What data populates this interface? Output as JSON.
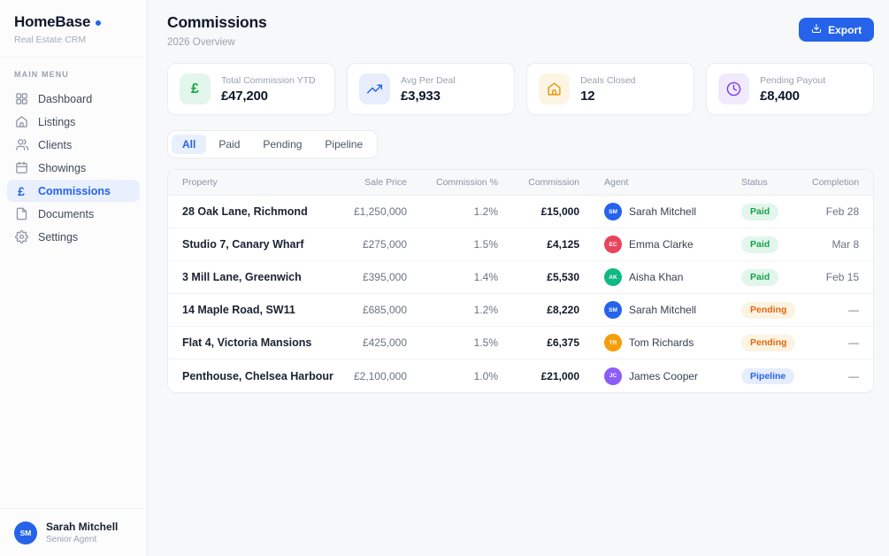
{
  "brand": {
    "name": "HomeBase",
    "subtitle": "Real Estate CRM",
    "accent_color": "#2563eb"
  },
  "sidebar": {
    "section_label": "MAIN MENU",
    "items": [
      {
        "label": "Dashboard",
        "icon": "dashboard-icon",
        "active": false
      },
      {
        "label": "Listings",
        "icon": "home-icon",
        "active": false
      },
      {
        "label": "Clients",
        "icon": "users-icon",
        "active": false
      },
      {
        "label": "Showings",
        "icon": "calendar-icon",
        "active": false
      },
      {
        "label": "Commissions",
        "icon": "pound-icon",
        "active": true
      },
      {
        "label": "Documents",
        "icon": "document-icon",
        "active": false
      },
      {
        "label": "Settings",
        "icon": "gear-icon",
        "active": false
      }
    ],
    "profile": {
      "initials": "SM",
      "name": "Sarah Mitchell",
      "role": "Senior Agent",
      "avatar_color": "#2563eb"
    }
  },
  "header": {
    "title": "Commissions",
    "subtitle": "2026 Overview"
  },
  "toolbar": {
    "export_label": "Export",
    "export_icon": "download-icon"
  },
  "stats": [
    {
      "label": "Total Commission YTD",
      "value": "£47,200",
      "icon": "pound-icon",
      "fg": "#16a34a",
      "bg": "#e3f6ec"
    },
    {
      "label": "Avg Per Deal",
      "value": "£3,933",
      "icon": "trending-up-icon",
      "fg": "#2563eb",
      "bg": "#e7edfc"
    },
    {
      "label": "Deals Closed",
      "value": "12",
      "icon": "home-icon",
      "fg": "#e8930c",
      "bg": "#fdf5e3"
    },
    {
      "label": "Pending Payout",
      "value": "£8,400",
      "icon": "clock-icon",
      "fg": "#7c3aed",
      "bg": "#f0eafd"
    }
  ],
  "filters": {
    "tabs": [
      {
        "label": "All",
        "active": true
      },
      {
        "label": "Paid",
        "active": false
      },
      {
        "label": "Pending",
        "active": false
      },
      {
        "label": "Pipeline",
        "active": false
      }
    ]
  },
  "table": {
    "columns": [
      "Property",
      "Sale Price",
      "Commission %",
      "Commission",
      "Agent",
      "Status",
      "Completion"
    ],
    "status_styles": {
      "Paid": {
        "bg": "#e2f6eb",
        "fg": "#17a24b"
      },
      "Pending": {
        "bg": "#fdf3e2",
        "fg": "#e2680f"
      },
      "Pipeline": {
        "bg": "#e6edfc",
        "fg": "#2563eb"
      }
    },
    "rows": [
      {
        "property": "28 Oak Lane, Richmond",
        "sale_price": "£1,250,000",
        "commission_pct": "1.2%",
        "commission": "£15,000",
        "agent": {
          "initials": "SM",
          "name": "Sarah Mitchell",
          "color": "#2563eb"
        },
        "status": "Paid",
        "completion": "Feb 28"
      },
      {
        "property": "Studio 7, Canary Wharf",
        "sale_price": "£275,000",
        "commission_pct": "1.5%",
        "commission": "£4,125",
        "agent": {
          "initials": "EC",
          "name": "Emma Clarke",
          "color": "#e8445e"
        },
        "status": "Paid",
        "completion": "Mar 8"
      },
      {
        "property": "3 Mill Lane, Greenwich",
        "sale_price": "£395,000",
        "commission_pct": "1.4%",
        "commission": "£5,530",
        "agent": {
          "initials": "AK",
          "name": "Aisha Khan",
          "color": "#10b981"
        },
        "status": "Paid",
        "completion": "Feb 15"
      },
      {
        "property": "14 Maple Road, SW11",
        "sale_price": "£685,000",
        "commission_pct": "1.2%",
        "commission": "£8,220",
        "agent": {
          "initials": "SM",
          "name": "Sarah Mitchell",
          "color": "#2563eb"
        },
        "status": "Pending",
        "completion": "—"
      },
      {
        "property": "Flat 4, Victoria Mansions",
        "sale_price": "£425,000",
        "commission_pct": "1.5%",
        "commission": "£6,375",
        "agent": {
          "initials": "TR",
          "name": "Tom Richards",
          "color": "#f59e0b"
        },
        "status": "Pending",
        "completion": "—"
      },
      {
        "property": "Penthouse, Chelsea Harbour",
        "sale_price": "£2,100,000",
        "commission_pct": "1.0%",
        "commission": "£21,000",
        "agent": {
          "initials": "JC",
          "name": "James Cooper",
          "color": "#8b5cf6"
        },
        "status": "Pipeline",
        "completion": "—"
      }
    ]
  }
}
